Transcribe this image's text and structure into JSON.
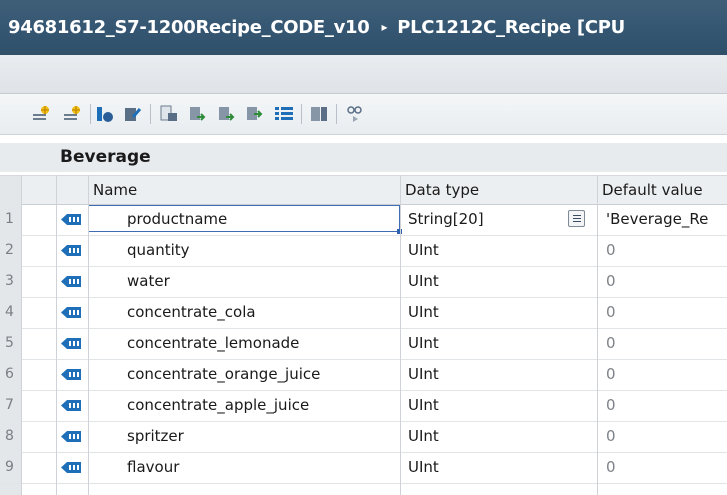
{
  "window": {
    "title_path": "94681612_S7-1200Recipe_CODE_v10",
    "title_sep": "▸",
    "title_device": "PLC1212C_Recipe [CPU"
  },
  "toolbar": {
    "icons": [
      "insert-row-icon",
      "add-row-icon",
      "expand-icon",
      "monitor-icon",
      "snapshot-icon",
      "copy-snapshot-icon",
      "load-start-values-icon",
      "apply-values-icon",
      "keep-actual-values-icon",
      "settings-icon",
      "show-monitoring-icon"
    ]
  },
  "block": {
    "name": "Beverage"
  },
  "columns": {
    "name": "Name",
    "data_type": "Data type",
    "default_value": "Default value"
  },
  "rows": [
    {
      "num": "1",
      "name": "productname",
      "data_type": "String[20]",
      "default_value": "'Beverage_Re",
      "selected": true
    },
    {
      "num": "2",
      "name": "quantity",
      "data_type": "UInt",
      "default_value": "0"
    },
    {
      "num": "3",
      "name": "water",
      "data_type": "UInt",
      "default_value": "0"
    },
    {
      "num": "4",
      "name": "concentrate_cola",
      "data_type": "UInt",
      "default_value": "0"
    },
    {
      "num": "5",
      "name": "concentrate_lemonade",
      "data_type": "UInt",
      "default_value": "0"
    },
    {
      "num": "6",
      "name": "concentrate_orange_juice",
      "data_type": "UInt",
      "default_value": "0"
    },
    {
      "num": "7",
      "name": "concentrate_apple_juice",
      "data_type": "UInt",
      "default_value": "0"
    },
    {
      "num": "8",
      "name": "spritzer",
      "data_type": "UInt",
      "default_value": "0"
    },
    {
      "num": "9",
      "name": "flavour",
      "data_type": "UInt",
      "default_value": "0"
    }
  ],
  "colors": {
    "titlebar": "#355672",
    "selection": "#3e6db5",
    "icon_blue": "#1f6fb8"
  }
}
